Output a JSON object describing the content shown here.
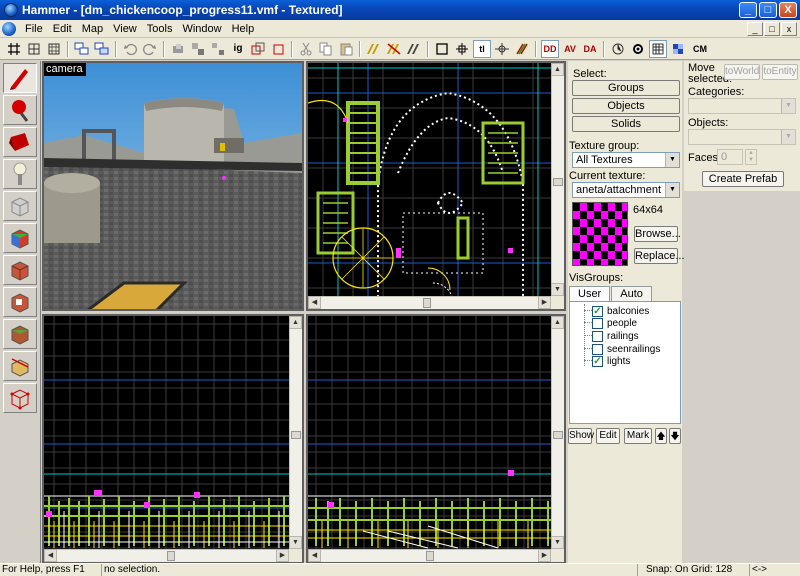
{
  "window": {
    "title": "Hammer - [dm_chickencoop_progress11.vmf - Textured]",
    "buttons": [
      "_",
      "□",
      "X"
    ]
  },
  "menubar": {
    "items": [
      "File",
      "Edit",
      "Map",
      "View",
      "Tools",
      "Window",
      "Help"
    ],
    "mdi_buttons": [
      "_",
      "□",
      "x"
    ]
  },
  "toolbar": {
    "cm_label": "CM"
  },
  "viewports": {
    "camera_label": "camera"
  },
  "select_panel": {
    "select_label": "Select:",
    "groups_button": "Groups",
    "objects_button": "Objects",
    "solids_button": "Solids",
    "texture_group_label": "Texture group:",
    "texture_group_value": "All Textures",
    "current_texture_label": "Current texture:",
    "current_texture_value": "aneta/attachment",
    "texture_size": "64x64",
    "browse_button": "Browse...",
    "replace_button": "Replace...",
    "visgroups_label": "VisGroups:",
    "tab_user": "User",
    "tab_auto": "Auto",
    "visgroups": [
      {
        "label": "balconies",
        "checked": true
      },
      {
        "label": "people",
        "checked": false
      },
      {
        "label": "railings",
        "checked": false
      },
      {
        "label": "seenrailings",
        "checked": false
      },
      {
        "label": "lights",
        "checked": true
      }
    ],
    "show_button": "Show",
    "edit_button": "Edit",
    "mark_button": "Mark",
    "up_arrow": "🡅",
    "down_arrow": "🡇"
  },
  "prefab_panel": {
    "move_selected_label": "Move selected:",
    "to_world_button": "toWorld",
    "to_entity_button": "toEntity",
    "categories_label": "Categories:",
    "objects_label": "Objects:",
    "faces_label": "Faces:",
    "faces_value": "0",
    "create_prefab_button": "Create Prefab"
  },
  "statusbar": {
    "help": "For Help, press F1",
    "selection": "no selection.",
    "snap": "Snap: On Grid: 128",
    "extra": "<->"
  }
}
